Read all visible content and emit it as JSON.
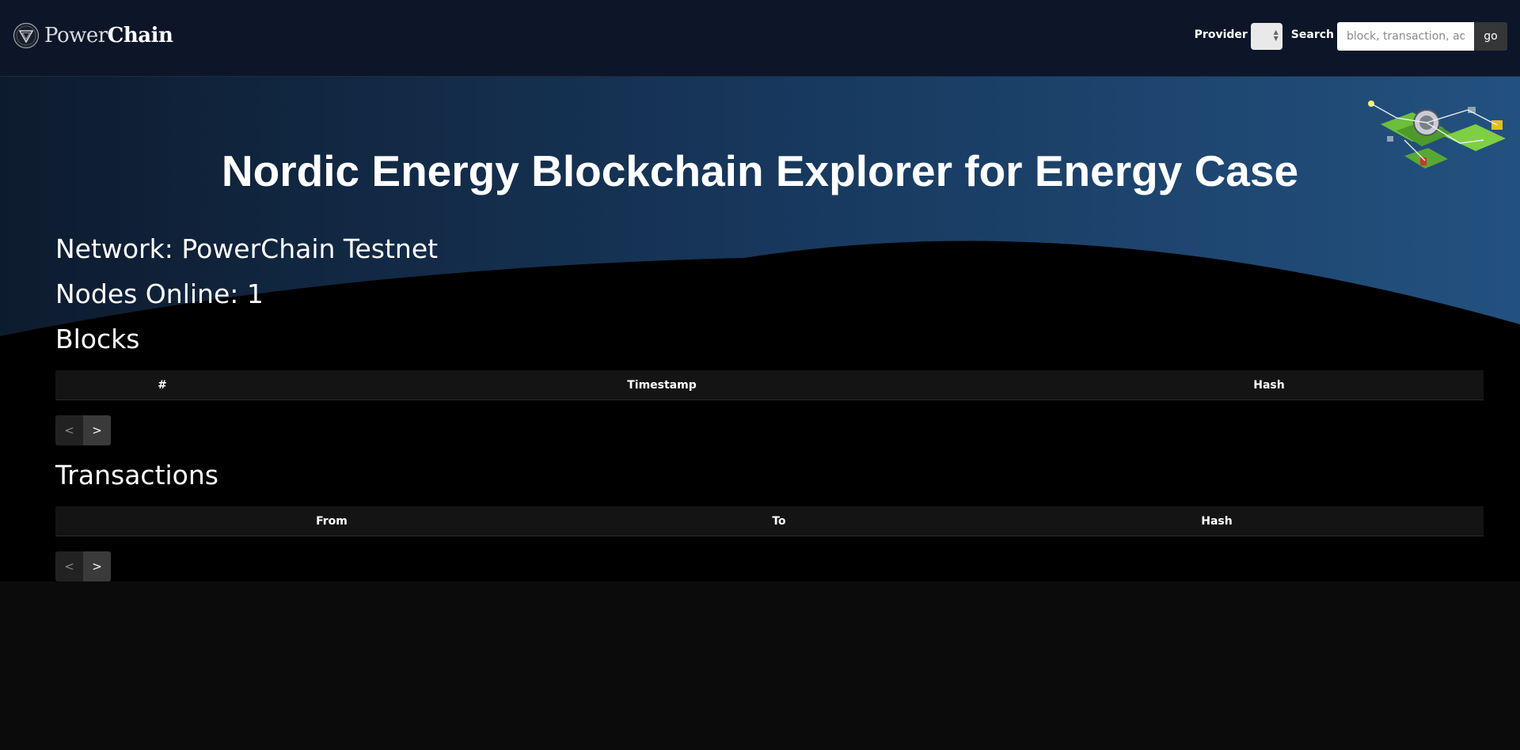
{
  "brand": {
    "name_light": "Power",
    "name_bold": "Chain"
  },
  "nav": {
    "provider_label": "Provider",
    "provider_value": "",
    "search_label": "Search",
    "search_placeholder": "block, transaction, address",
    "go_label": "go"
  },
  "hero": {
    "title": "Nordic Energy Blockchain Explorer for Energy Case"
  },
  "network": {
    "label": "Network: PowerChain Testnet"
  },
  "nodes": {
    "label": "Nodes Online: 1"
  },
  "blocks": {
    "title": "Blocks",
    "columns": [
      "#",
      "Timestamp",
      "Hash"
    ],
    "rows": [],
    "prev_label": "<",
    "next_label": ">"
  },
  "transactions": {
    "title": "Transactions",
    "columns": [
      "From",
      "To",
      "Hash"
    ],
    "rows": [],
    "prev_label": "<",
    "next_label": ">"
  },
  "colors": {
    "navbar_bg": "#0c1628",
    "hero_gradient_start": "#0d1b2e",
    "hero_gradient_end": "#23517f",
    "page_bg": "#0b0b0b",
    "table_header_bg": "#141414"
  }
}
